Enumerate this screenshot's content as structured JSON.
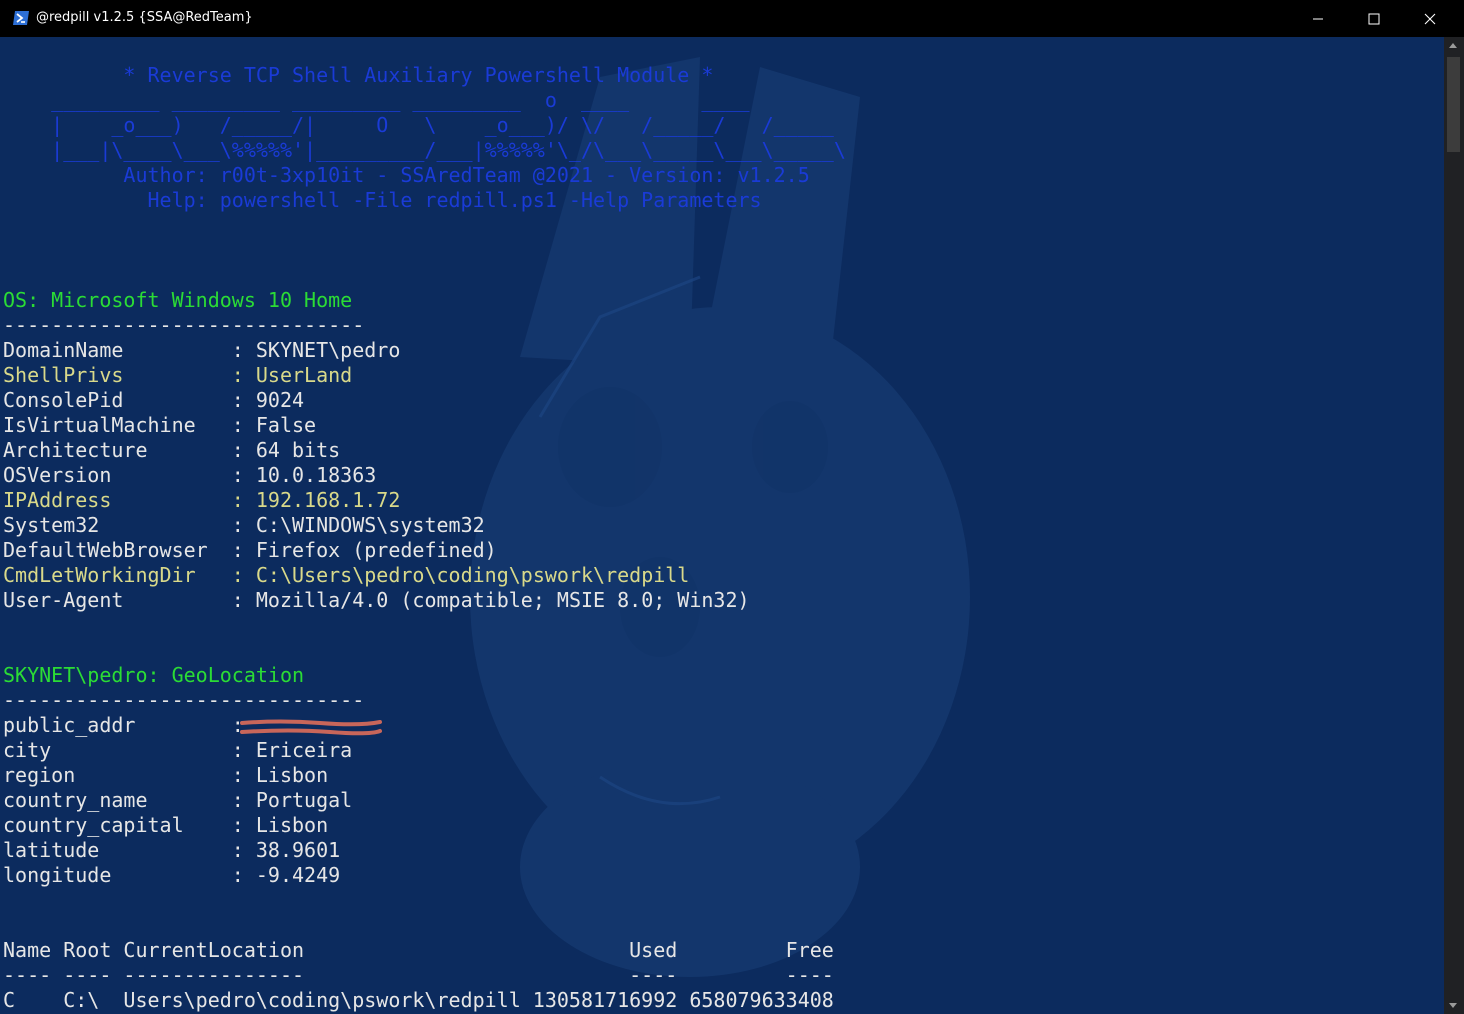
{
  "window": {
    "title": "@redpill v1.2.5 {SSA@RedTeam}",
    "app_icon": "powershell-icon",
    "buttons": [
      "minimize-icon",
      "maximize-icon",
      "close-icon"
    ]
  },
  "colors": {
    "background": "#0c2b5e",
    "banner": "#1a3bd6",
    "header_green": "#2bdc35",
    "highlight_yellow": "#d9d98a",
    "text": "#e6e6e6",
    "redaction": "#c8665a"
  },
  "banner": {
    "module_line": "          * Reverse TCP Shell Auxiliary Powershell Module *",
    "art1": "    _________ _________ _________ _________  o  ____      ____",
    "art2": "    |    _o___)   /_____/|     O   \\    _o___)/ \\/   /_____/   /_____",
    "art3": "    |___|\\____\\___\\%%%%%'|_________/___|%%%%%'\\_/\\___\\_____\\___\\_____\\",
    "author": "          Author: r00t-3xp10it - SSAredTeam @2021 - Version: v1.2.5",
    "help": "            Help: powershell -File redpill.ps1 -Help Parameters"
  },
  "os_section": {
    "header": "OS: Microsoft Windows 10 Home",
    "separator": "------------------------------",
    "rows": [
      {
        "key": "DomainName         ",
        "value": "SKYNET\\pedro"
      },
      {
        "key": "ShellPrivs         ",
        "value": "UserLand"
      },
      {
        "key": "ConsolePid         ",
        "value": "9024"
      },
      {
        "key": "IsVirtualMachine   ",
        "value": "False"
      },
      {
        "key": "Architecture       ",
        "value": "64 bits"
      },
      {
        "key": "OSVersion          ",
        "value": "10.0.18363"
      },
      {
        "key": "IPAddress          ",
        "value": "192.168.1.72"
      },
      {
        "key": "System32           ",
        "value": "C:\\WINDOWS\\system32"
      },
      {
        "key": "DefaultWebBrowser  ",
        "value": "Firefox (predefined)"
      },
      {
        "key": "CmdLetWorkingDir   ",
        "value": "C:\\Users\\pedro\\coding\\pswork\\redpill"
      },
      {
        "key": "User-Agent         ",
        "value": "Mozilla/4.0 (compatible; MSIE 8.0; Win32)"
      }
    ]
  },
  "geo_section": {
    "header": "SKYNET\\pedro: GeoLocation",
    "separator": "------------------------------",
    "rows": [
      {
        "key": "public_addr        ",
        "value": ""
      },
      {
        "key": "city               ",
        "value": "Ericeira"
      },
      {
        "key": "region             ",
        "value": "Lisbon"
      },
      {
        "key": "country_name       ",
        "value": "Portugal"
      },
      {
        "key": "country_capital    ",
        "value": "Lisbon"
      },
      {
        "key": "latitude           ",
        "value": "38.9601"
      },
      {
        "key": "longitude          ",
        "value": "-9.4249"
      }
    ]
  },
  "drive_table": {
    "header": "Name Root CurrentLocation                           Used         Free",
    "underline": "---- ---- ---------------                           ----         ----",
    "row": "C    C:\\  Users\\pedro\\coding\\pswork\\redpill 130581716992 658079633408"
  }
}
